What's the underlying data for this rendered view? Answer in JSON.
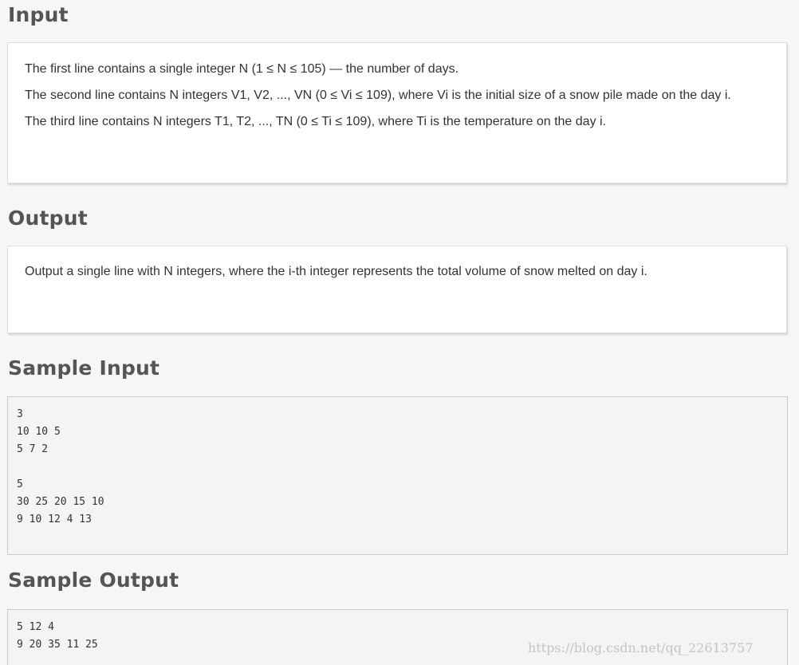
{
  "input_section": {
    "heading": "Input",
    "lines": [
      "The first line contains a single integer N (1 ≤ N ≤ 105) — the number of days.",
      "The second line contains N integers V1, V2, ..., VN (0 ≤ Vi ≤ 109), where Vi is the initial size of a snow pile made on the day i.",
      "The third line contains N integers T1, T2, ..., TN (0 ≤ Ti ≤ 109), where Ti is the temperature on the day i."
    ]
  },
  "output_section": {
    "heading": "Output",
    "lines": [
      "Output a single line with N integers, where the i-th integer represents the total volume of snow melted on day i."
    ]
  },
  "sample_input": {
    "heading": "Sample Input",
    "lines": [
      "3",
      "10 10 5",
      "5 7 2",
      "",
      "5",
      "30 25 20 15 10",
      "9 10 12 4 13"
    ]
  },
  "sample_output": {
    "heading": "Sample Output",
    "lines": [
      "5 12 4",
      "9 20 35 11 25"
    ]
  },
  "watermark": "https://blog.csdn.net/qq_22613757"
}
